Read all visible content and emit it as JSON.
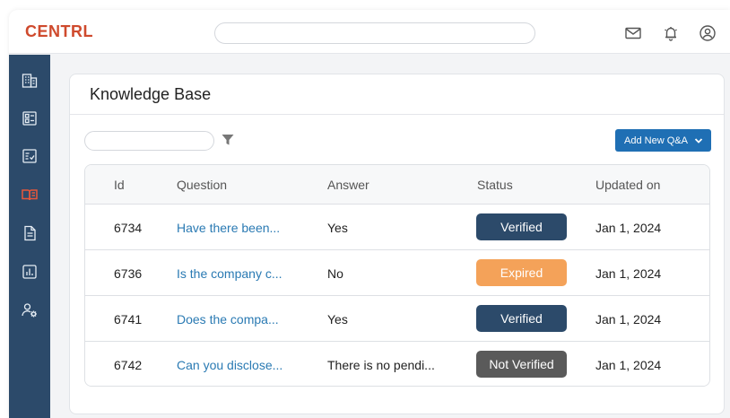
{
  "app": {
    "logo": "CENTRL",
    "search_placeholder": ""
  },
  "topbar_icons": [
    "mail-icon",
    "bell-icon",
    "user-icon"
  ],
  "sidebar": {
    "items": [
      {
        "name": "buildings",
        "active": false
      },
      {
        "name": "dashboard",
        "active": false
      },
      {
        "name": "checklist",
        "active": false
      },
      {
        "name": "knowledge-base",
        "active": true
      },
      {
        "name": "document",
        "active": false
      },
      {
        "name": "reports",
        "active": false
      },
      {
        "name": "user-settings",
        "active": false
      }
    ]
  },
  "panel": {
    "title": "Knowledge Base",
    "search_placeholder": "",
    "add_button": "Add New Q&A"
  },
  "table": {
    "headers": {
      "id": "Id",
      "question": "Question",
      "answer": "Answer",
      "status": "Status",
      "updated": "Updated on"
    },
    "rows": [
      {
        "id": "6734",
        "question": "Have there been...",
        "answer": "Yes",
        "status": "Verified",
        "updated": "Jan 1, 2024"
      },
      {
        "id": "6736",
        "question": "Is the company c...",
        "answer": "No",
        "status": "Expired",
        "updated": "Jan 1, 2024"
      },
      {
        "id": "6741",
        "question": "Does the compa...",
        "answer": "Yes",
        "status": "Verified",
        "updated": "Jan 1, 2024"
      },
      {
        "id": "6742",
        "question": "Can you disclose...",
        "answer": "There is no pendi...",
        "status": "Not Verified",
        "updated": "Jan 1, 2024"
      }
    ]
  },
  "colors": {
    "brand": "#cf4a2d",
    "sidebar": "#2c4a6a",
    "link": "#2a7ab3",
    "button": "#1f6fb4",
    "status_verified": "#2c4a6a",
    "status_expired": "#f4a259",
    "status_not_verified": "#5a5a5a"
  }
}
